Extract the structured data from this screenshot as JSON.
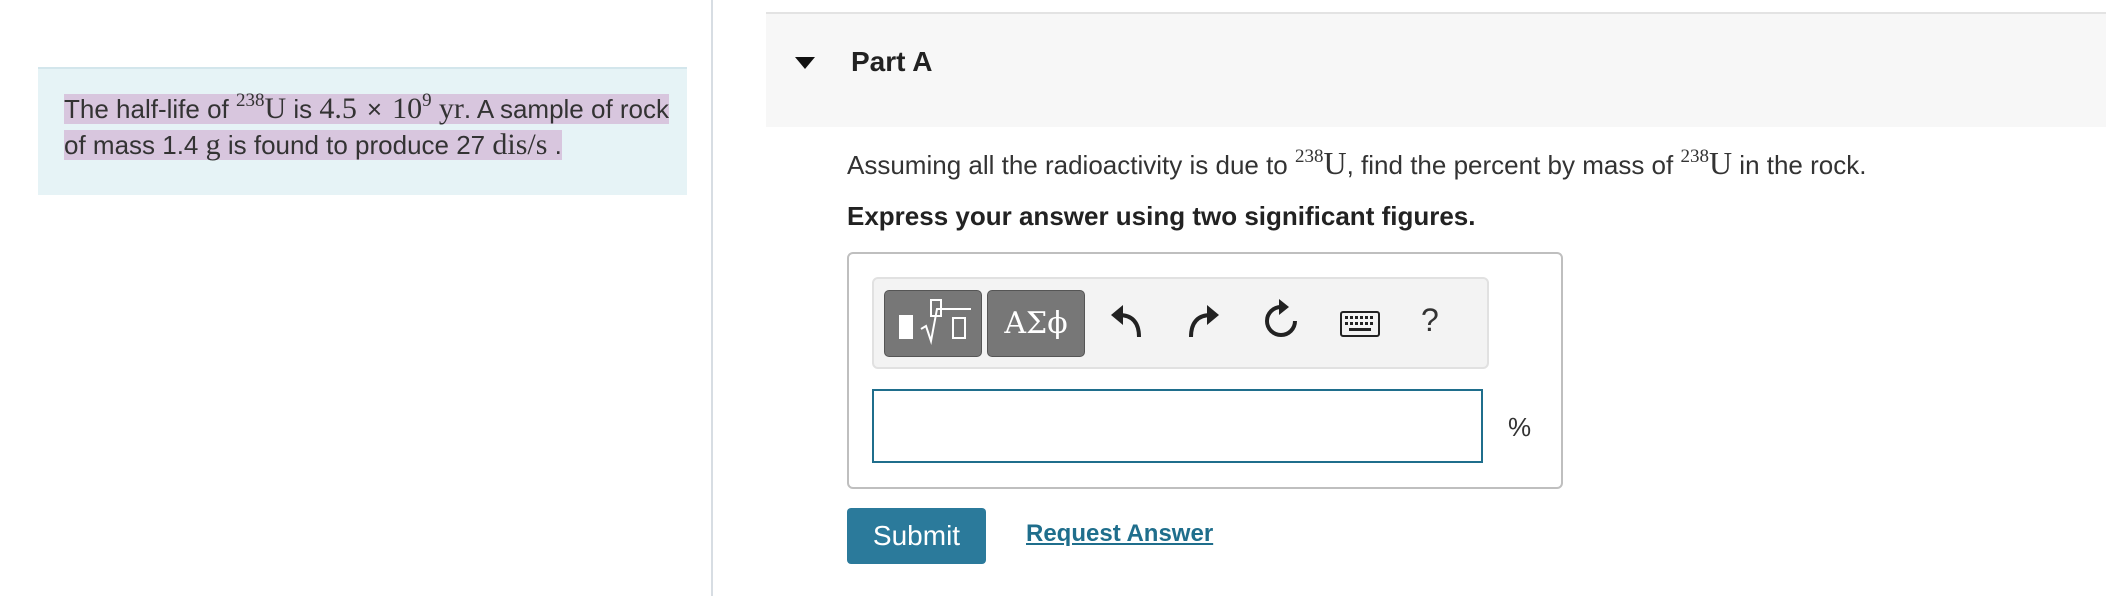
{
  "problem": {
    "intro": "The half-life of ",
    "isotope_mass": "238",
    "isotope_symbol": "U",
    "is": " is ",
    "halflife_coef": "4.5",
    "times": "×",
    "halflife_base": "10",
    "halflife_exp": "9",
    "halflife_unit": "yr",
    "sentence2_a": ". A sample of rock of mass 1.4 ",
    "mass_unit": "g",
    "sentence2_b": " is found to produce 27 ",
    "rate_unit": "dis/s",
    "period": " ."
  },
  "part": {
    "title": "Part A",
    "question_a": "Assuming all the radioactivity is due to ",
    "isotope_mass": "238",
    "isotope_symbol": "U",
    "question_b": ", find the percent by mass of ",
    "question_c": " in the rock.",
    "instruction": "Express your answer using two significant figures."
  },
  "toolbar": {
    "templates_icon": "fraction-sqrt-template-icon",
    "greek_label": "ΑΣϕ",
    "undo_icon": "undo-icon",
    "redo_icon": "redo-icon",
    "reset_icon": "reset-icon",
    "keyboard_icon": "keyboard-icon",
    "help_label": "?"
  },
  "answer": {
    "value": "",
    "unit": "%"
  },
  "buttons": {
    "submit": "Submit",
    "request_answer": "Request Answer"
  }
}
